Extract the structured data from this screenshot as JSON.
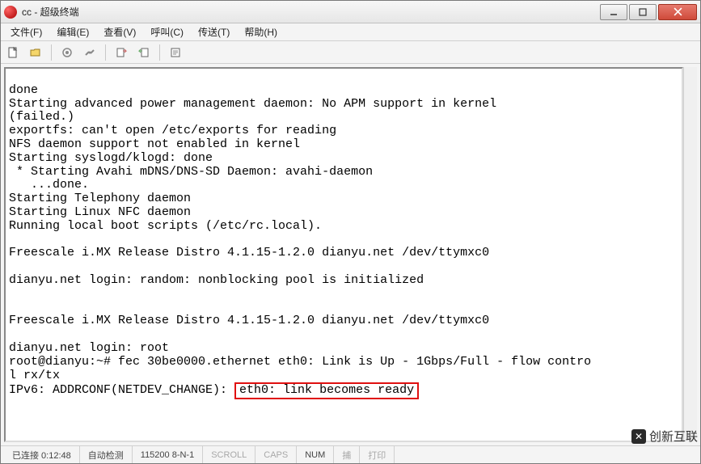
{
  "titlebar": {
    "title": "cc - 超级终端"
  },
  "menu": {
    "file": "文件(F)",
    "edit": "编辑(E)",
    "view": "查看(V)",
    "call": "呼叫(C)",
    "transfer": "传送(T)",
    "help": "帮助(H)"
  },
  "terminal": {
    "lines": [
      "",
      "done",
      "Starting advanced power management daemon: No APM support in kernel",
      "(failed.)",
      "exportfs: can't open /etc/exports for reading",
      "NFS daemon support not enabled in kernel",
      "Starting syslogd/klogd: done",
      " * Starting Avahi mDNS/DNS-SD Daemon: avahi-daemon",
      "   ...done.",
      "Starting Telephony daemon",
      "Starting Linux NFC daemon",
      "Running local boot scripts (/etc/rc.local).",
      "",
      "Freescale i.MX Release Distro 4.1.15-1.2.0 dianyu.net /dev/ttymxc0",
      "",
      "dianyu.net login: random: nonblocking pool is initialized",
      "",
      "",
      "Freescale i.MX Release Distro 4.1.15-1.2.0 dianyu.net /dev/ttymxc0",
      "",
      "dianyu.net login: root",
      "root@dianyu:~# fec 30be0000.ethernet eth0: Link is Up - 1Gbps/Full - flow contro",
      "l rx/tx"
    ],
    "last_line_prefix": "IPv6: ADDRCONF(NETDEV_CHANGE): ",
    "last_line_highlight": "eth0: link becomes ready"
  },
  "statusbar": {
    "connected": "已连接 0:12:48",
    "autodetect": "自动检测",
    "baud": "115200 8-N-1",
    "scroll": "SCROLL",
    "caps": "CAPS",
    "num": "NUM",
    "capture": "捕",
    "print": "打印"
  },
  "watermark": {
    "label": "创新互联"
  }
}
